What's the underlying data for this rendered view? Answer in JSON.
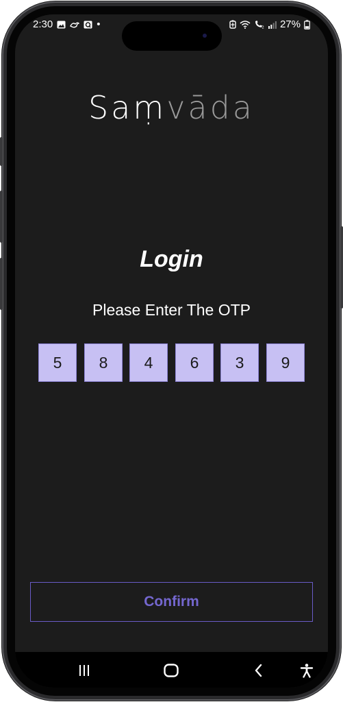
{
  "status_bar": {
    "time": "2:30",
    "dot": "•",
    "battery": "27%",
    "left_icons": [
      "gallery-icon",
      "bird-icon",
      "q-app-icon"
    ],
    "right_icons": [
      "battery-saver-icon",
      "wifi-icon",
      "call-icon",
      "signal-icon",
      "battery-icon"
    ]
  },
  "app": {
    "logo_part_a": "Saṃ",
    "logo_part_b": "vāda",
    "title": "Login",
    "prompt": "Please Enter The OTP",
    "otp_digits": [
      "5",
      "8",
      "4",
      "6",
      "3",
      "9"
    ],
    "confirm_label": "Confirm"
  },
  "nav_bar": {
    "icons": [
      "recent-apps-icon",
      "home-icon",
      "back-icon",
      "accessibility-icon"
    ]
  },
  "colors": {
    "background": "#1c1c1c",
    "otp_box": "#c7c0f3",
    "accent": "#7467cf"
  }
}
